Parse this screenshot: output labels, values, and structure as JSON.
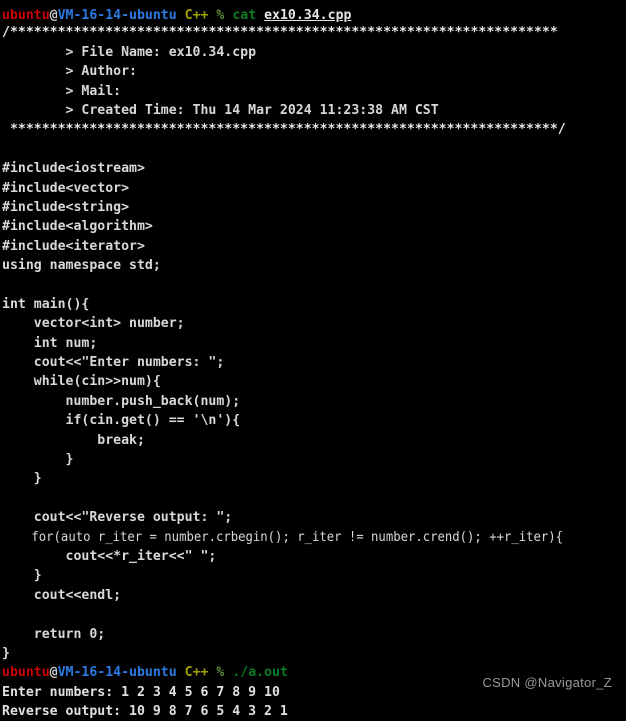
{
  "terminal": {
    "background_color": "#000000",
    "prompt": {
      "user": "ubuntu",
      "at": "@",
      "host": "VM-16-14-ubuntu",
      "env": "C++",
      "symbol": "%",
      "colors": {
        "user": "#cc0000",
        "host": "#2a7ae2",
        "env": "#a0a000",
        "symbol": "#5f8f3f",
        "command": "#0a7d22",
        "text": "#e0e0e0"
      }
    },
    "commands": {
      "cat": "cat",
      "cat_arg": "ex10.34.cpp",
      "run": "./a.out"
    },
    "header_comment": {
      "open_slash": "/",
      "stars_top": "*********************************************************************",
      "lines": [
        "        > File Name: ex10.34.cpp",
        "        > Author: ",
        "        > Mail: ",
        "        > Created Time: Thu 14 Mar 2024 11:23:38 AM CST"
      ],
      "stars_bottom": " *********************************************************************",
      "close_slash": "/"
    },
    "source_lines": [
      "#include<iostream>",
      "#include<vector>",
      "#include<string>",
      "#include<algorithm>",
      "#include<iterator>",
      "using namespace std;",
      "",
      "int main(){",
      "    vector<int> number;",
      "    int num;",
      "    cout<<\"Enter numbers: \";",
      "    while(cin>>num){",
      "        number.push_back(num);",
      "        if(cin.get() == '\\n'){",
      "            break;",
      "        }",
      "    }",
      "",
      "    cout<<\"Reverse output: \";",
      "    for(auto r_iter = number.crbegin(); r_iter != number.crend(); ++r_iter){",
      "        cout<<*r_iter<<\" \";",
      "    }",
      "    cout<<endl;",
      "",
      "    return 0;",
      "}"
    ],
    "program_output": {
      "enter_numbers_label": "Enter numbers: ",
      "enter_numbers_values": "1 2 3 4 5 6 7 8 9 10",
      "reverse_output_label": "Reverse output: ",
      "reverse_output_values": "10 9 8 7 6 5 4 3 2 1"
    }
  },
  "watermark": {
    "text": "CSDN @Navigator_Z",
    "color": "#9a9a9a"
  }
}
